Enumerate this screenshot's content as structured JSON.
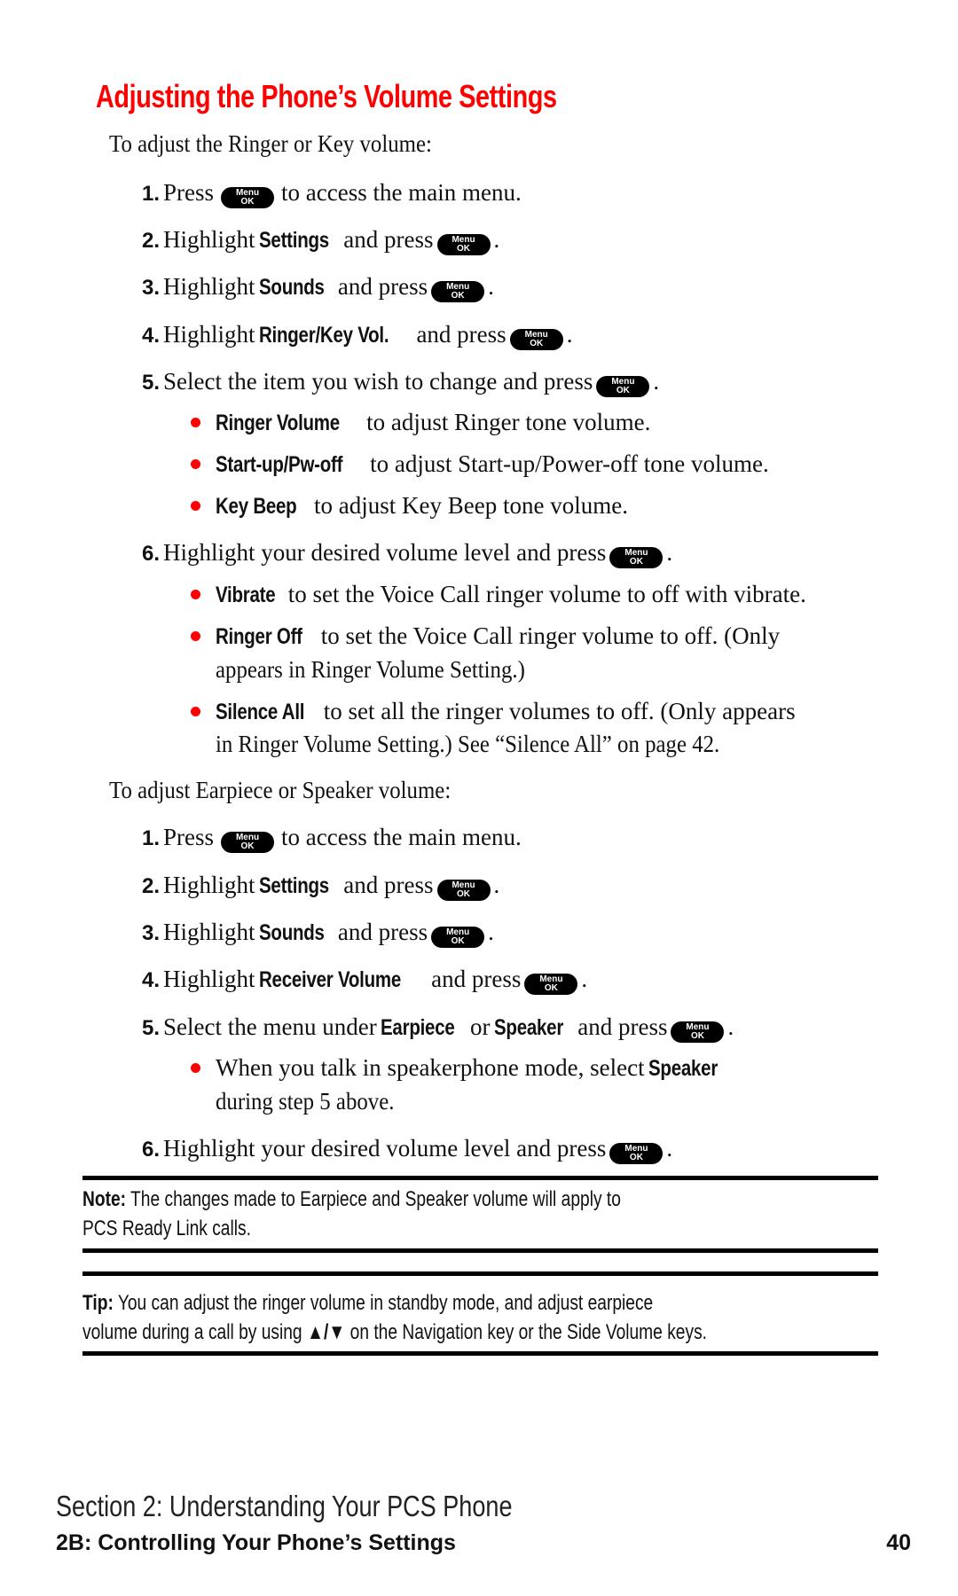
{
  "heading": "Adjusting the Phone’s Volume Settings",
  "menu_key": {
    "top": "Menu",
    "bottom": "OK",
    "icon": "menu-ok-key-icon"
  },
  "bullet_color": "#ff0000",
  "section1": {
    "intro": "To adjust the Ringer or Key volume:",
    "steps": [
      {
        "num": "1.",
        "pre": "Press",
        "post": "to access the main menu."
      },
      {
        "num": "2.",
        "pre": "Highlight",
        "bold": "Settings",
        "post": "and press",
        "end": "."
      },
      {
        "num": "3.",
        "pre": "Highlight",
        "bold": "Sounds",
        "post": "and press",
        "end": "."
      },
      {
        "num": "4.",
        "pre": "Highlight",
        "bold": "Ringer/Key Vol.",
        "post": "and press",
        "end": "."
      },
      {
        "num": "5.",
        "pre": "Select the item you wish to change and press",
        "end": "."
      },
      {
        "num": "6.",
        "pre": "Highlight your desired volume level and press",
        "end": "."
      }
    ],
    "step5_bullets": [
      {
        "bold": "Ringer Volume",
        "text": "to adjust Ringer tone volume."
      },
      {
        "bold": "Start-up/Pw-off",
        "text": "to adjust Start-up/Power-off tone volume."
      },
      {
        "bold": "Key Beep",
        "text": "to adjust Key Beep tone volume."
      }
    ],
    "step6_bullets": [
      {
        "bold": "Vibrate",
        "text": "to set the Voice Call ringer volume to off with vibrate."
      },
      {
        "bold": "Ringer Off",
        "text": "to set the Voice Call ringer volume to off. (Only",
        "text2": "appears in Ringer Volume Setting.)"
      },
      {
        "bold": "Silence All",
        "text": "to set all the ringer volumes to off. (Only appears",
        "text2": "in Ringer Volume Setting.) See “Silence All” on page 42."
      }
    ]
  },
  "section2": {
    "intro": "To adjust Earpiece or Speaker volume:",
    "steps": [
      {
        "num": "1.",
        "pre": "Press",
        "post": "to access the main menu."
      },
      {
        "num": "2.",
        "pre": "Highlight",
        "bold": "Settings",
        "post": "and press",
        "end": "."
      },
      {
        "num": "3.",
        "pre": "Highlight",
        "bold": "Sounds",
        "post": "and press",
        "end": "."
      },
      {
        "num": "4.",
        "pre": "Highlight",
        "bold": "Receiver Volume",
        "post": "and press",
        "end": "."
      },
      {
        "num": "5.",
        "pre": "Select the menu under",
        "bold": "Earpiece",
        "mid": "or",
        "bold2": "Speaker",
        "post": "and press",
        "end": "."
      },
      {
        "num": "6.",
        "pre": "Highlight your desired volume level and press",
        "end": "."
      }
    ],
    "step5_bullet": {
      "text": "When you talk in speakerphone mode, select",
      "bold": "Speaker",
      "text2": "during step 5 above."
    }
  },
  "note": {
    "label": "Note:",
    "line1": "The changes made to Earpiece and Speaker volume will apply to",
    "line2": "PCS Ready Link calls."
  },
  "tip": {
    "label": "Tip:",
    "line1": "You can adjust the ringer volume in standby mode, and adjust earpiece",
    "line2_pre": "volume during a call by using",
    "arrows": "▲/▼",
    "line2_post": "on the Navigation key or the Side Volume keys."
  },
  "footer": {
    "section": "Section 2: Understanding Your PCS Phone",
    "chapter": "2B: Controlling Your Phone’s Settings",
    "page": "40"
  }
}
